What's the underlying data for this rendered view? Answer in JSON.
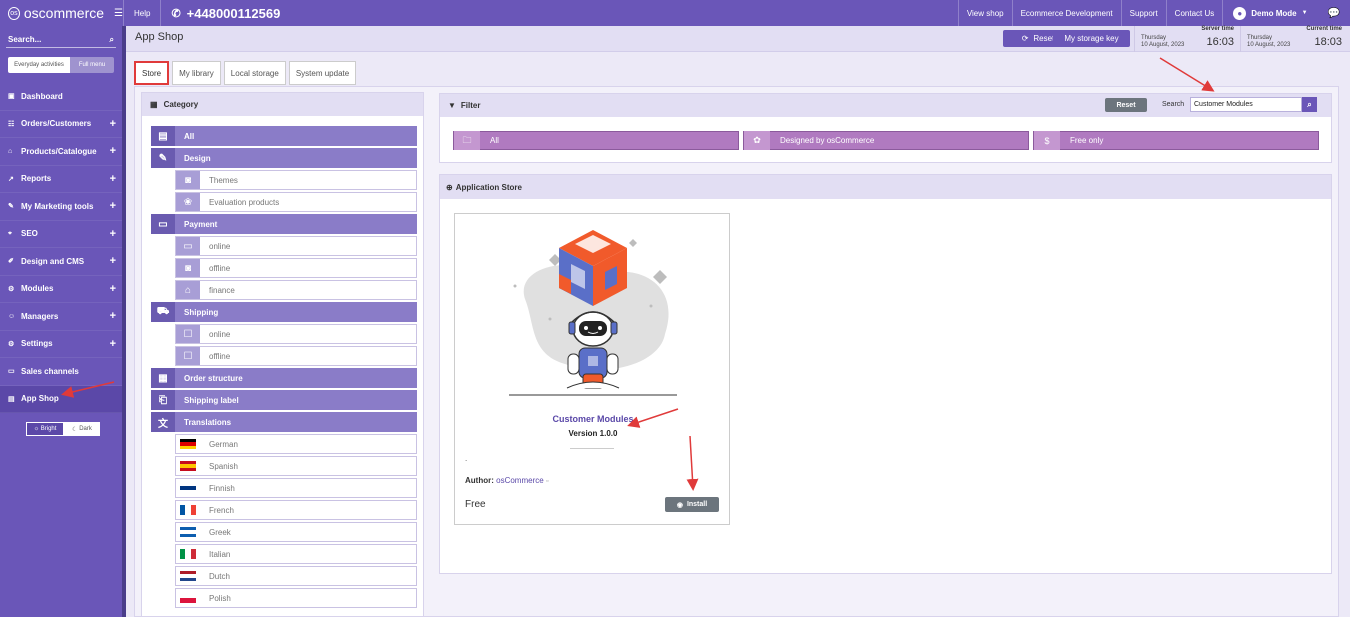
{
  "topbar": {
    "logo": "oscommerce",
    "help": "Help",
    "phone": "+448000112569",
    "links": [
      "View shop",
      "Ecommerce Development",
      "Support",
      "Contact Us"
    ],
    "user": "Demo Mode"
  },
  "sidebar": {
    "search_placeholder": "Search...",
    "toggle_everyday": "Everyday activities",
    "toggle_full": "Full menu",
    "items": [
      {
        "label": "Dashboard",
        "icon": "dashboard-icon",
        "plus": ""
      },
      {
        "label": "Orders/Customers",
        "icon": "users-icon",
        "plus": "+"
      },
      {
        "label": "Products/Catalogue",
        "icon": "tags-icon",
        "plus": "+"
      },
      {
        "label": "Reports",
        "icon": "chart-icon",
        "plus": "+"
      },
      {
        "label": "My Marketing tools",
        "icon": "marketing-icon",
        "plus": "+"
      },
      {
        "label": "SEO",
        "icon": "seo-icon",
        "plus": "+"
      },
      {
        "label": "Design and CMS",
        "icon": "brush-icon",
        "plus": "+"
      },
      {
        "label": "Modules",
        "icon": "modules-icon",
        "plus": "+"
      },
      {
        "label": "Managers",
        "icon": "managers-icon",
        "plus": "+"
      },
      {
        "label": "Settings",
        "icon": "gear-icon",
        "plus": "+"
      },
      {
        "label": "Sales channels",
        "icon": "monitor-icon",
        "plus": ""
      },
      {
        "label": "App Shop",
        "icon": "shop-icon",
        "plus": ""
      }
    ],
    "theme_bright": "Bright",
    "theme_dark": "Dark"
  },
  "header": {
    "title": "App Shop",
    "reset": "Reset",
    "storage_key": "My storage key",
    "server_time": {
      "label": "Server time",
      "day": "Thursday",
      "date": "10 August, 2023",
      "time": "16:03"
    },
    "current_time": {
      "label": "Current time",
      "day": "Thursday",
      "date": "10 August, 2023",
      "time": "18:03"
    }
  },
  "tabs": [
    "Store",
    "My library",
    "Local storage",
    "System update"
  ],
  "category": {
    "title": "Category",
    "rows": [
      {
        "label": "All",
        "type": "main"
      },
      {
        "label": "Design",
        "type": "main"
      },
      {
        "label": "Themes",
        "type": "sub"
      },
      {
        "label": "Evaluation products",
        "type": "sub"
      },
      {
        "label": "Payment",
        "type": "main"
      },
      {
        "label": "online",
        "type": "sub"
      },
      {
        "label": "offline",
        "type": "sub"
      },
      {
        "label": "finance",
        "type": "sub"
      },
      {
        "label": "Shipping",
        "type": "main"
      },
      {
        "label": "online",
        "type": "sub"
      },
      {
        "label": "offline",
        "type": "sub"
      },
      {
        "label": "Order structure",
        "type": "main"
      },
      {
        "label": "Shipping label",
        "type": "main"
      },
      {
        "label": "Translations",
        "type": "main"
      },
      {
        "label": "German",
        "type": "sub"
      },
      {
        "label": "Spanish",
        "type": "sub"
      },
      {
        "label": "Finnish",
        "type": "sub"
      },
      {
        "label": "French",
        "type": "sub"
      },
      {
        "label": "Greek",
        "type": "sub"
      },
      {
        "label": "Italian",
        "type": "sub"
      },
      {
        "label": "Dutch",
        "type": "sub"
      },
      {
        "label": "Polish",
        "type": "sub"
      }
    ]
  },
  "filter": {
    "title": "Filter",
    "reset": "Reset",
    "search_label": "Search",
    "search_value": "Customer Modules",
    "options": [
      "All",
      "Designed by osCommerce",
      "Free only"
    ]
  },
  "store": {
    "title": "Application Store",
    "card": {
      "name": "Customer Modules",
      "version": "Version 1.0.0",
      "dot": ".",
      "author_label": "Author:",
      "author": "osCommerce",
      "price": "Free",
      "install": "Install"
    }
  },
  "colors": {
    "primary": "#6a56b8",
    "option": "#b07ac0",
    "highlight": "#e03a3a"
  }
}
